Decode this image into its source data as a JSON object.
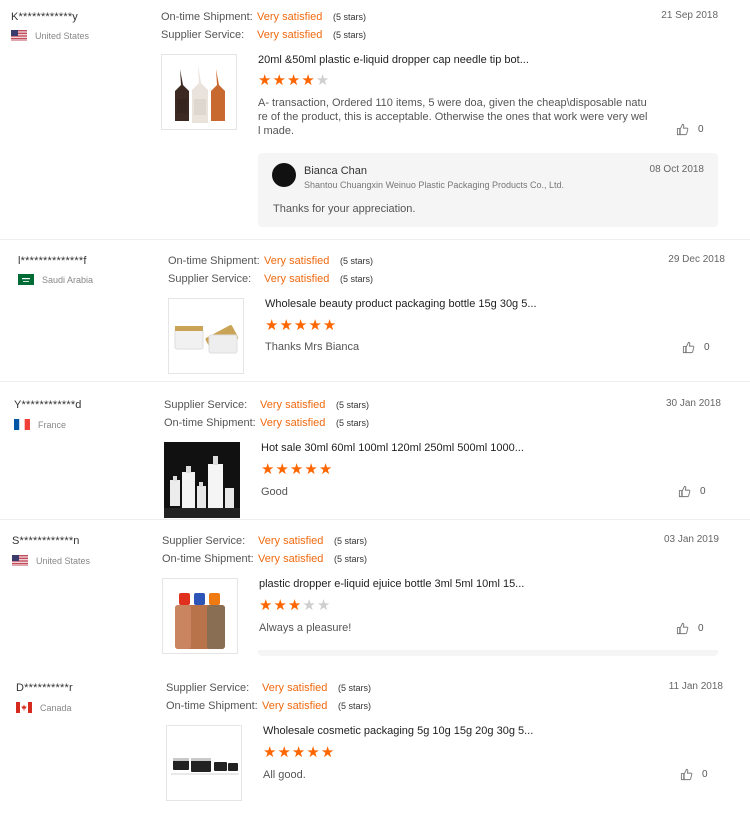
{
  "reviews": [
    {
      "buyer": "K************y",
      "country": "United States",
      "flag": "us",
      "ratings": [
        {
          "label": "On-time Shipment:",
          "value": "Very satisfied",
          "stars": "(5 stars)"
        },
        {
          "label": "Supplier Service:",
          "value": "Very satisfied",
          "stars": "(5 stars)"
        }
      ],
      "date": "21 Sep 2018",
      "product_title": "20ml &50ml plastic e-liquid dropper cap needle tip bot...",
      "product_rating": 4,
      "text_lines": [
        "A- transaction, Ordered 110 items, 5 were doa, given the cheap\\disposable natu",
        "re of the product, this is acceptable. Otherwise the ones that work were very wel",
        "l made."
      ],
      "likes": "0",
      "reply": {
        "name": "Bianca Chan",
        "company": "Shantou Chuangxin Weinuo Plastic Packaging Products Co., Ltd.",
        "date": "08 Oct 2018",
        "text": "Thanks for your appreciation."
      }
    },
    {
      "buyer": "l**************f",
      "country": "Saudi Arabia",
      "flag": "sa",
      "ratings": [
        {
          "label": "On-time Shipment:",
          "value": "Very satisfied",
          "stars": "(5 stars)"
        },
        {
          "label": "Supplier Service:",
          "value": "Very satisfied",
          "stars": "(5 stars)"
        }
      ],
      "date": "29 Dec 2018",
      "product_title": "Wholesale beauty product packaging bottle 15g 30g 5...",
      "product_rating": 5,
      "text_lines": [
        "Thanks Mrs Bianca"
      ],
      "likes": "0"
    },
    {
      "buyer": "Y************d",
      "country": "France",
      "flag": "fr",
      "ratings": [
        {
          "label": "Supplier Service:",
          "value": "Very satisfied",
          "stars": "(5 stars)"
        },
        {
          "label": "On-time Shipment:",
          "value": "Very satisfied",
          "stars": "(5 stars)"
        }
      ],
      "date": "30 Jan 2018",
      "product_title": "Hot sale 30ml 60ml 100ml 120ml 250ml 500ml 1000...",
      "product_rating": 5,
      "text_lines": [
        "Good"
      ],
      "likes": "0"
    },
    {
      "buyer": "S************n",
      "country": "United States",
      "flag": "us",
      "ratings": [
        {
          "label": "Supplier Service:",
          "value": "Very satisfied",
          "stars": "(5 stars)"
        },
        {
          "label": "On-time Shipment:",
          "value": "Very satisfied",
          "stars": "(5 stars)"
        }
      ],
      "date": "03 Jan 2019",
      "product_title": "plastic dropper e-liquid ejuice bottle 3ml 5ml 10ml 15...",
      "product_rating": 3,
      "text_lines": [
        "Always a pleasure!"
      ],
      "likes": "0"
    },
    {
      "buyer": "D**********r",
      "country": "Canada",
      "flag": "ca",
      "ratings": [
        {
          "label": "Supplier Service:",
          "value": "Very satisfied",
          "stars": "(5 stars)"
        },
        {
          "label": "On-time Shipment:",
          "value": "Very satisfied",
          "stars": "(5 stars)"
        }
      ],
      "date": "11 Jan 2018",
      "product_title": "Wholesale cosmetic packaging 5g 10g 15g 20g 30g 5...",
      "product_rating": 5,
      "text_lines": [
        "All good."
      ],
      "likes": "0"
    }
  ],
  "colors": {
    "accent": "#f06a10",
    "star": "#ff6600",
    "star_empty": "#cfcfcf",
    "reply_bg": "#f5f5f5"
  }
}
